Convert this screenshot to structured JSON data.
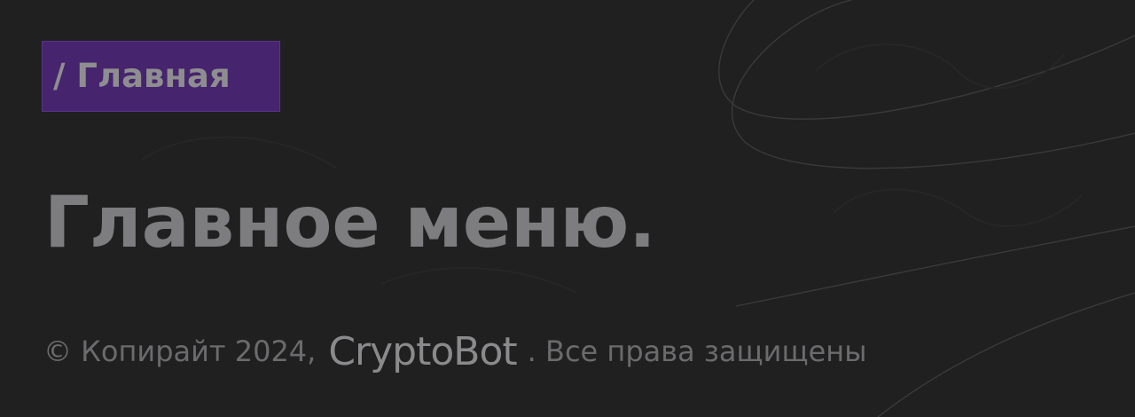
{
  "breadcrumb": {
    "label": "/ Главная"
  },
  "main": {
    "title": "Главное меню."
  },
  "footer": {
    "copyright_prefix": "© Копирайт 2024,",
    "brand": "CryptoBot",
    "rights_text": ". Все права защищены"
  },
  "colors": {
    "background": "#202021",
    "accent": "#46246e",
    "title_text": "#7d7d7f",
    "footer_text": "#6b6b6d"
  }
}
